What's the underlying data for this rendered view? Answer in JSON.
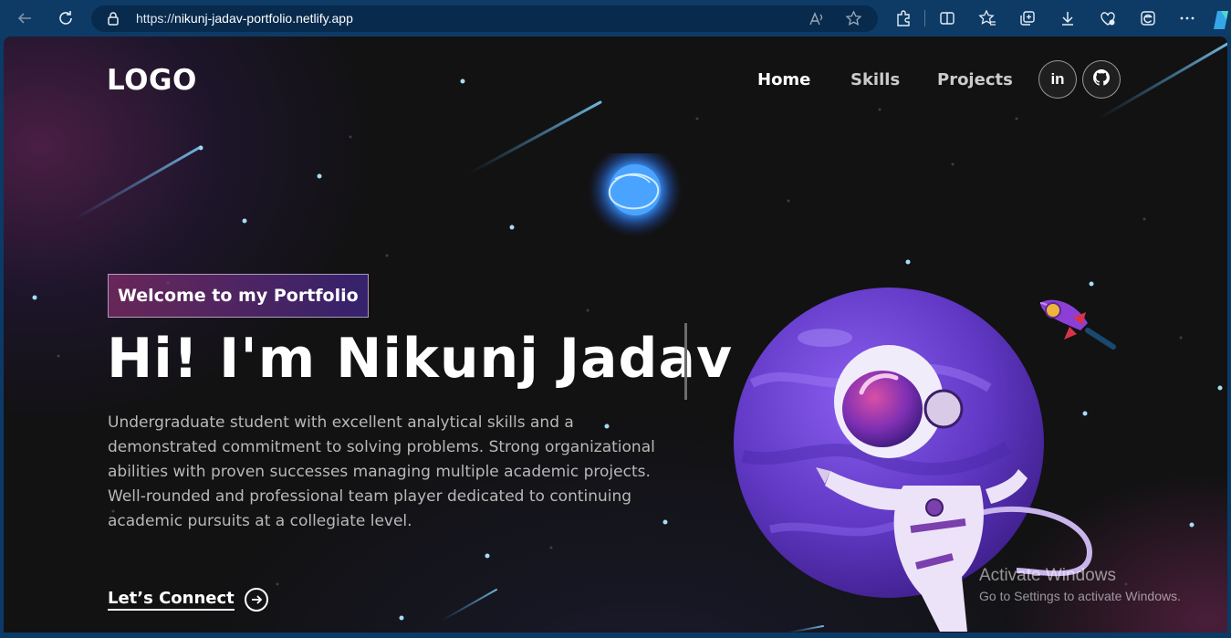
{
  "browser": {
    "url_prefix": "https://",
    "url_domain": "nikunj-jadav-portfolio.netlify.app",
    "icons": [
      "back-icon",
      "refresh-icon",
      "lock-icon",
      "read-aloud-icon",
      "favorite-star-icon",
      "extensions-icon",
      "split-screen-icon",
      "favorites-icon",
      "collections-icon",
      "downloads-icon",
      "browser-essentials-icon",
      "edge-icon",
      "more-icon"
    ]
  },
  "header": {
    "logo": "LOGO",
    "nav": [
      {
        "label": "Home",
        "active": true
      },
      {
        "label": "Skills",
        "active": false
      },
      {
        "label": "Projects",
        "active": false
      }
    ],
    "social": [
      {
        "name": "linkedin",
        "glyph": "in"
      },
      {
        "name": "github",
        "glyph": ""
      }
    ]
  },
  "hero": {
    "tagline": "Welcome to my Portfolio",
    "title": "Hi! I'm Nikunj Jadav",
    "description": "Undergraduate student with excellent analytical skills and a demonstrated commitment to solving problems. Strong organizational abilities with proven successes managing multiple academic projects. Well-rounded and professional team player dedicated to continuing academic pursuits at a collegiate level.",
    "cta_label": "Let’s Connect"
  },
  "watermark": {
    "title": "Activate Windows",
    "subtitle": "Go to Settings to activate Windows."
  },
  "colors": {
    "background": "#121213",
    "tagline_gradient_start": "#aa367c",
    "tagline_gradient_end": "#4a2fbd",
    "planet": "#6a3fd0",
    "browser_chrome": "#0d3b66"
  }
}
